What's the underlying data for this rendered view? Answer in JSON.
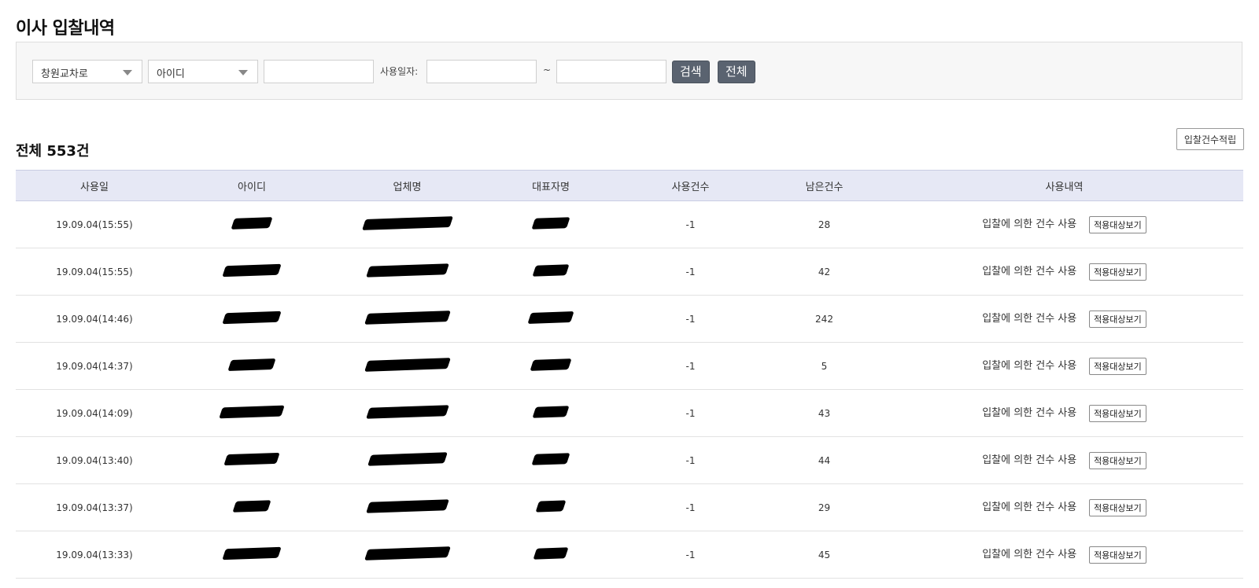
{
  "page": {
    "title": "이사 입찰내역"
  },
  "search": {
    "region_select": "창원교차로",
    "field_select": "아이디",
    "keyword_value": "",
    "date_label": "사용일자:",
    "date_from": "",
    "date_separator": "~",
    "date_to": "",
    "search_button": "검색",
    "all_button": "전체"
  },
  "summary": {
    "total_label": "전체 553건",
    "accumulate_button": "입찰건수적립"
  },
  "table": {
    "headers": [
      "사용일",
      "아이디",
      "업체명",
      "대표자명",
      "사용건수",
      "남은건수",
      "사용내역"
    ],
    "view_button": "적용대상보기",
    "rows": [
      {
        "date": "19.09.04(15:55)",
        "used": "-1",
        "remaining": "28",
        "history": "입찰에 의한 건수 사용"
      },
      {
        "date": "19.09.04(15:55)",
        "used": "-1",
        "remaining": "42",
        "history": "입찰에 의한 건수 사용"
      },
      {
        "date": "19.09.04(14:46)",
        "used": "-1",
        "remaining": "242",
        "history": "입찰에 의한 건수 사용"
      },
      {
        "date": "19.09.04(14:37)",
        "used": "-1",
        "remaining": "5",
        "history": "입찰에 의한 건수 사용"
      },
      {
        "date": "19.09.04(14:09)",
        "used": "-1",
        "remaining": "43",
        "history": "입찰에 의한 건수 사용"
      },
      {
        "date": "19.09.04(13:40)",
        "used": "-1",
        "remaining": "44",
        "history": "입찰에 의한 건수 사용"
      },
      {
        "date": "19.09.04(13:37)",
        "used": "-1",
        "remaining": "29",
        "history": "입찰에 의한 건수 사용"
      },
      {
        "date": "19.09.04(13:33)",
        "used": "-1",
        "remaining": "45",
        "history": "입찰에 의한 건수 사용"
      }
    ]
  },
  "icons": {
    "dropdown": "chevron-down-icon"
  },
  "colors": {
    "header_bg": "#e6e8f5",
    "button_dark": "#5a6370"
  }
}
